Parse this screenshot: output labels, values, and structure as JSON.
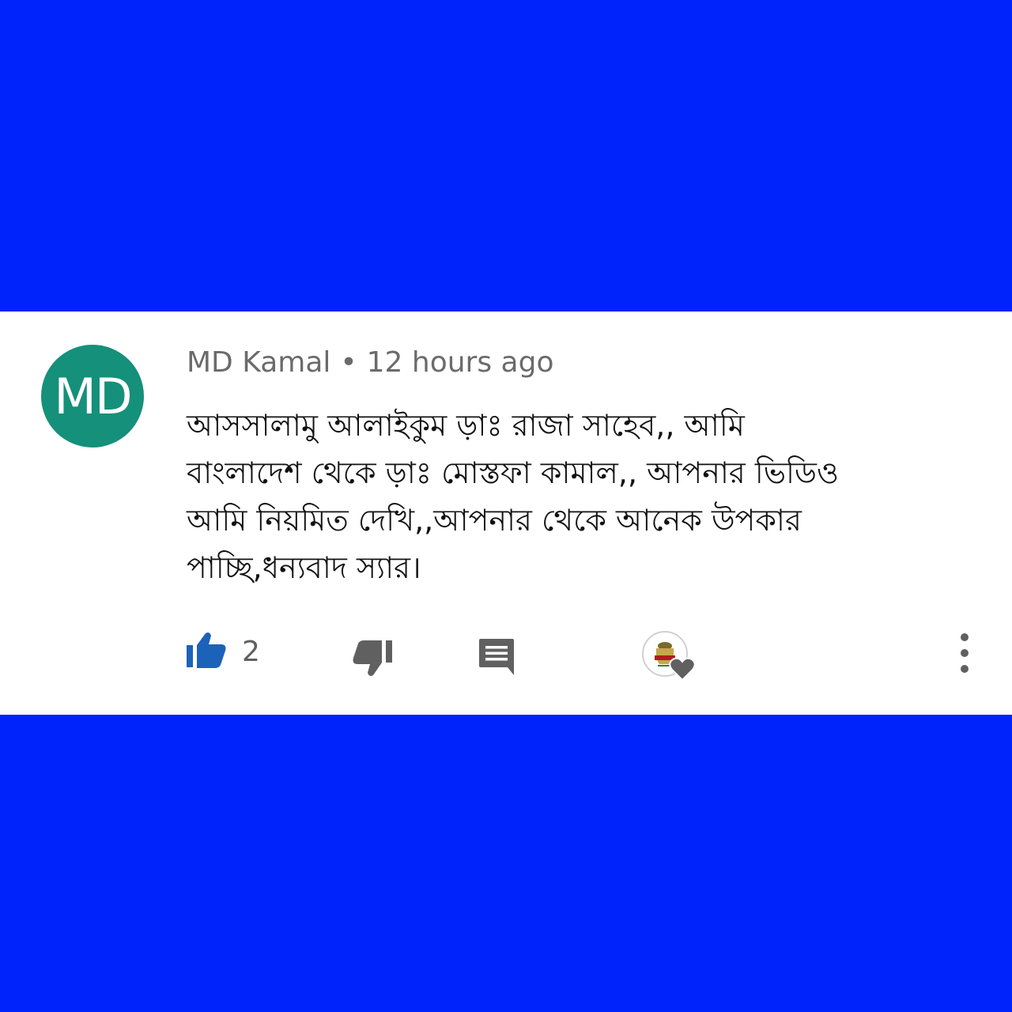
{
  "colors": {
    "background": "#0023fb",
    "card": "#ffffff",
    "avatar": "#15907a",
    "like": "#1c62b9",
    "icon_gray": "#606060"
  },
  "comment": {
    "avatar_initials": "MD",
    "author": "MD Kamal",
    "separator": "•",
    "timestamp": "12 hours ago",
    "text_lines": [
      "আসসালামু আলাইকুম ড়াঃ রাজা সাহেব,, আমি",
      "বাংলাদেশ থেকে ড়াঃ মোস্তফা কামাল,, আপনার  ভিডিও",
      "আমি নিয়মিত দেখি,,আপনার থেকে আনেক উপকার",
      "পাচ্ছি,ধন্যবাদ স্যার।"
    ]
  },
  "actions": {
    "like_count": "2",
    "like_icon": "thumbs-up-filled",
    "dislike_icon": "thumbs-down",
    "reply_icon": "comment-bubble",
    "creator_heart_icon": "heart",
    "more_icon": "vertical-ellipsis"
  }
}
